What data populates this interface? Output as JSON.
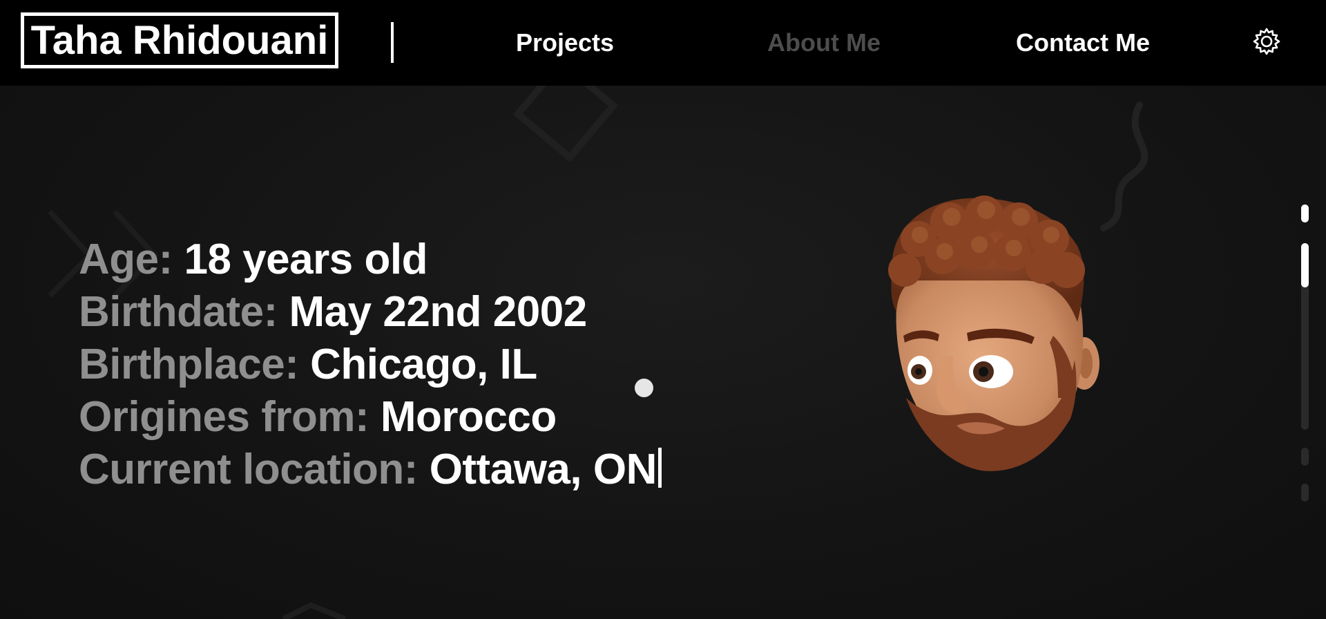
{
  "header": {
    "logo_text": "Taha Rhidouani",
    "nav": [
      {
        "label": "Projects",
        "active": false
      },
      {
        "label": "About Me",
        "active": true
      },
      {
        "label": "Contact Me",
        "active": false
      }
    ],
    "settings_icon": "gear-icon"
  },
  "about": {
    "rows": [
      {
        "label": "Age:",
        "value": "18 years old"
      },
      {
        "label": "Birthdate:",
        "value": "May 22nd 2002"
      },
      {
        "label": "Birthplace:",
        "value": "Chicago, IL"
      },
      {
        "label": "Origines from:",
        "value": "Morocco"
      },
      {
        "label": "Current location:",
        "value": "Ottawa, ON"
      }
    ],
    "avatar_icon": "memoji-avatar"
  },
  "scroll_nav": {
    "sections": 5,
    "active_index": 1
  },
  "colors": {
    "background": "#131313",
    "header": "#000000",
    "label": "#8f8f8f",
    "value": "#ffffff",
    "nav_active": "#4d4d4d"
  }
}
